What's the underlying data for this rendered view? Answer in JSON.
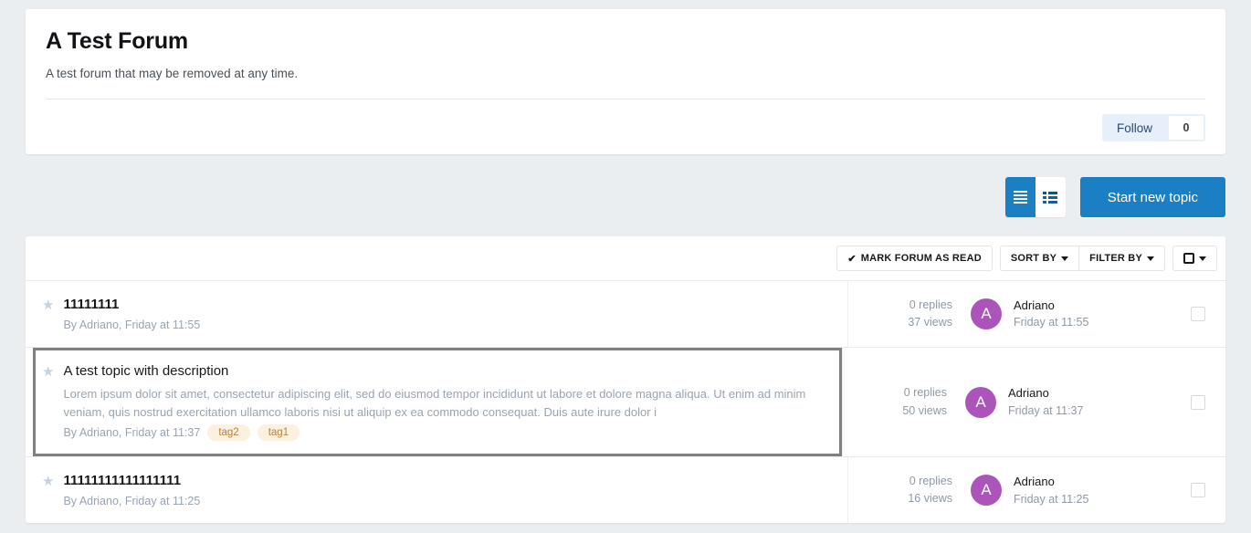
{
  "forum": {
    "title": "A Test Forum",
    "description": "A test forum that may be removed at any time.",
    "follow_label": "Follow",
    "follow_count": "0"
  },
  "topbar": {
    "view_list_icon": "list-view-icon",
    "view_grid_icon": "grid-view-icon",
    "start_topic_label": "Start new topic"
  },
  "list_toolbar": {
    "mark_read_label": "MARK FORUM AS READ",
    "mark_read_check": "✔",
    "sort_by_label": "SORT BY",
    "filter_by_label": "FILTER BY"
  },
  "topics": [
    {
      "title": "11111111",
      "description": "",
      "meta": "By Adriano, Friday at 11:55",
      "tags": [],
      "replies": "0 replies",
      "views": "37 views",
      "avatar_letter": "A",
      "last_author": "Adriano",
      "last_time": "Friday at 11:55",
      "highlighted": false,
      "bold_title": true
    },
    {
      "title": "A test topic with description",
      "description": "Lorem ipsum dolor sit amet, consectetur adipiscing elit, sed do eiusmod tempor incididunt ut labore et dolore magna aliqua. Ut enim ad minim veniam, quis nostrud exercitation ullamco laboris nisi ut aliquip ex ea commodo consequat. Duis aute irure dolor i",
      "meta": "By Adriano, Friday at 11:37",
      "tags": [
        "tag2",
        "tag1"
      ],
      "replies": "0 replies",
      "views": "50 views",
      "avatar_letter": "A",
      "last_author": "Adriano",
      "last_time": "Friday at 11:37",
      "highlighted": true,
      "bold_title": false
    },
    {
      "title": "11111111111111111",
      "description": "",
      "meta": "By Adriano, Friday at 11:25",
      "tags": [],
      "replies": "0 replies",
      "views": "16 views",
      "avatar_letter": "A",
      "last_author": "Adriano",
      "last_time": "Friday at 11:25",
      "highlighted": false,
      "bold_title": true
    }
  ],
  "colors": {
    "accent": "#1b7fc4",
    "page_bg": "#ebeef1",
    "avatar": "#ab55ba",
    "tag_bg": "#fdf0de",
    "tag_text": "#b5813c",
    "highlight_border": "#808080"
  }
}
